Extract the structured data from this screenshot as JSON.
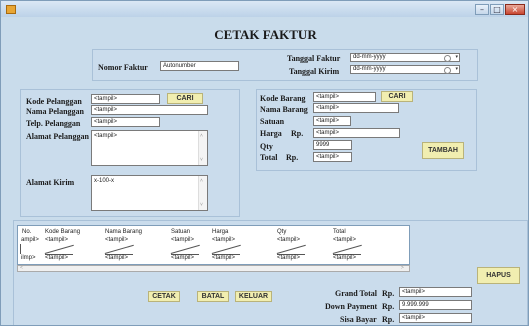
{
  "window": {
    "title": "CETAK FAKTUR"
  },
  "header": {
    "nomor_faktur_label": "Nomor Faktur",
    "nomor_faktur_value": "Autonumber",
    "tanggal_faktur_label": "Tanggal Faktur",
    "tanggal_faktur_value": "dd-mm-yyyy",
    "tanggal_kirim_label": "Tanggal Kirim",
    "tanggal_kirim_value": "dd-mm-yyyy"
  },
  "pelanggan": {
    "kode_label": "Kode Pelanggan",
    "kode_value": "<tampil>",
    "cari_label": "CARI",
    "nama_label": "Nama Pelanggan",
    "nama_value": "<tampil>",
    "telp_label": "Telp. Pelanggan",
    "telp_value": "<tampil>",
    "alamat_label": "Alamat Pelanggan",
    "alamat_value": "<tampil>",
    "alamat_kirim_label": "Alamat Kirim",
    "alamat_kirim_value": "x-100-x"
  },
  "barang": {
    "kode_label": "Kode Barang",
    "kode_value": "<tampil>",
    "cari_label": "CARI",
    "nama_label": "Nama Barang",
    "nama_value": "<tampil>",
    "satuan_label": "Satuan",
    "satuan_value": "<tampil>",
    "harga_label": "Harga",
    "harga_rp": "Rp.",
    "harga_value": "<tampil>",
    "qty_label": "Qty",
    "qty_value": "9999",
    "total_label": "Total",
    "total_rp": "Rp.",
    "total_value": "<tampil>",
    "tambah_label": "TAMBAH"
  },
  "grid": {
    "columns": [
      "No.",
      "Kode Barang",
      "Nama Barang",
      "Satuan",
      "Harga",
      "Qty",
      "Total"
    ],
    "row1": [
      "ampil>",
      "<tampil>",
      "<tampil>",
      "<tampil>",
      "<tampil>",
      "<tampil>",
      "<tampil>"
    ],
    "row2": [
      "ilmp>",
      "<tampil>",
      "<tampil>",
      "<tampil>",
      "<tampil>",
      "<tampil>",
      "<tampil>"
    ],
    "scroll_left": "<",
    "scroll_right": ">"
  },
  "actions": {
    "hapus_label": "HAPUS",
    "cetak_label": "CETAK",
    "batal_label": "BATAL",
    "keluar_label": "KELUAR"
  },
  "summary": {
    "grand_total_label": "Grand Total",
    "grand_total_rp": "Rp.",
    "grand_total_value": "<tampil>",
    "down_payment_label": "Down Payment",
    "down_payment_rp": "Rp.",
    "down_payment_value": "9.999.999",
    "sisa_bayar_label": "Sisa Bayar",
    "sisa_bayar_rp": "Rp.",
    "sisa_bayar_value": "<tampil>"
  }
}
